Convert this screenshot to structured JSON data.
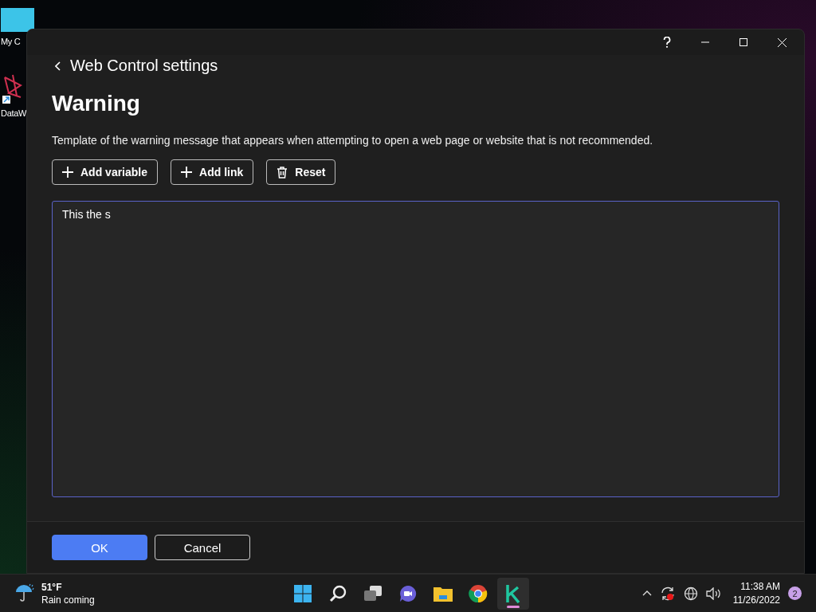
{
  "desktop_icons": [
    {
      "kind": "monitor",
      "label": "My C"
    },
    {
      "kind": "app",
      "label": "DataW"
    }
  ],
  "window": {
    "back_label": "Web Control settings",
    "heading": "Warning",
    "description": "Template of the warning message that appears when attempting to open a web page or website that is not recommended.",
    "toolbar_buttons": [
      {
        "kind": "add",
        "label": "Add variable"
      },
      {
        "kind": "add",
        "label": "Add link"
      },
      {
        "kind": "reset",
        "label": "Reset"
      }
    ],
    "editor": {
      "value": "This the s"
    },
    "footer_buttons": [
      {
        "kind": "primary",
        "label": "OK"
      },
      {
        "kind": "secondary",
        "label": "Cancel"
      }
    ]
  },
  "taskbar": {
    "weather": {
      "temperature": "51°F",
      "condition": "Rain coming"
    },
    "apps": [
      {
        "kind": "start",
        "selected": false
      },
      {
        "kind": "search",
        "selected": false
      },
      {
        "kind": "taskview",
        "selected": false
      },
      {
        "kind": "chat",
        "selected": false
      },
      {
        "kind": "explorer",
        "selected": false
      },
      {
        "kind": "browser",
        "selected": false
      },
      {
        "kind": "k",
        "selected": true
      }
    ],
    "time": "11:38 AM",
    "date": "11/26/2022",
    "notification_count": "2"
  }
}
